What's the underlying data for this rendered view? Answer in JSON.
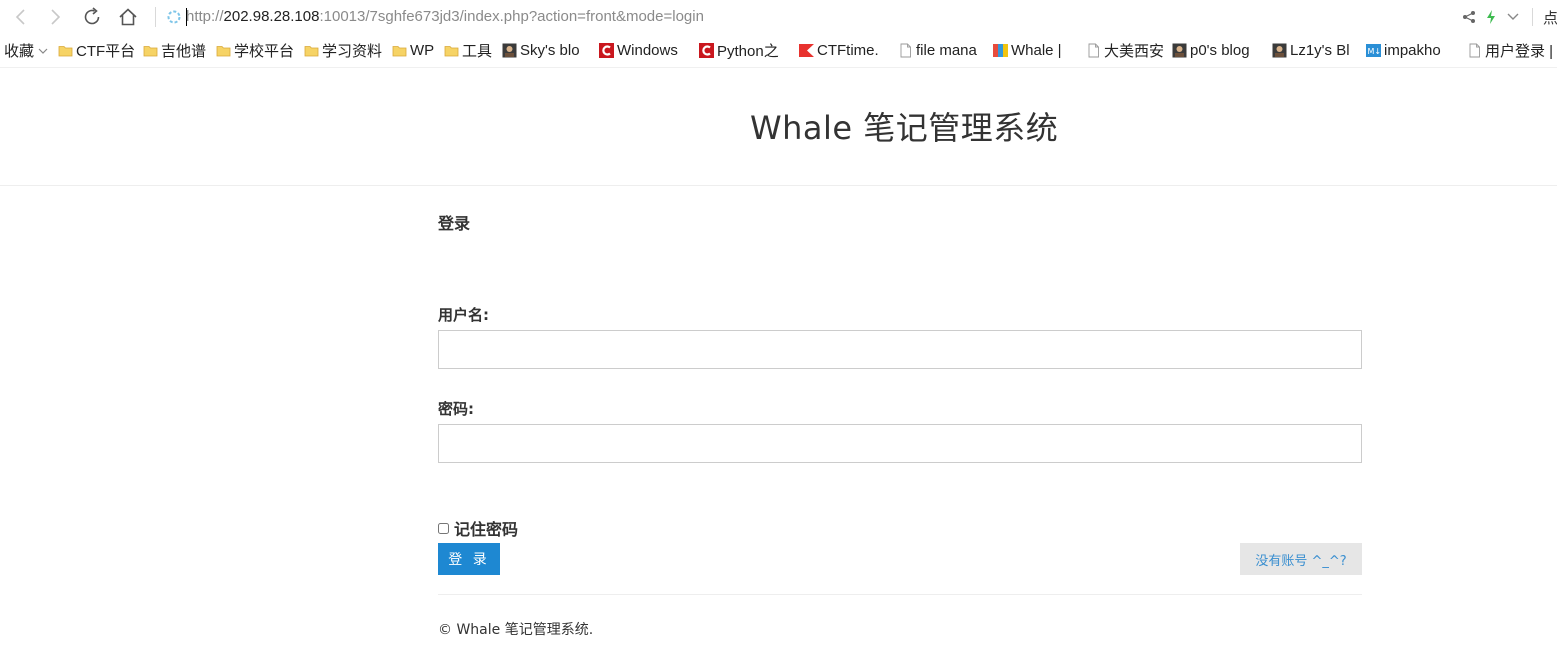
{
  "browser": {
    "url_scheme": "http://",
    "url_host": "202.98.28.108",
    "url_rest": ":10013/7sghfe673jd3/index.php?action=front&mode=login",
    "right_cut_text": "点"
  },
  "bookmarks": {
    "favorites_label": "收藏",
    "items": [
      {
        "label": "CTF平台",
        "icon": "folder-icon"
      },
      {
        "label": "吉他谱",
        "icon": "folder-icon"
      },
      {
        "label": "学校平台",
        "icon": "folder-icon"
      },
      {
        "label": "学习资料",
        "icon": "folder-icon"
      },
      {
        "label": "WP",
        "icon": "folder-icon"
      },
      {
        "label": "工具",
        "icon": "folder-icon"
      },
      {
        "label": "Sky's blo",
        "icon": "avatar-icon"
      },
      {
        "label": "Windows",
        "icon": "csdn-icon"
      },
      {
        "label": "Python之",
        "icon": "csdn-icon"
      },
      {
        "label": "CTFtime.",
        "icon": "ctftime-icon"
      },
      {
        "label": "file mana",
        "icon": "page-icon"
      },
      {
        "label": "Whale |",
        "icon": "whale-icon"
      },
      {
        "label": "大美西安",
        "icon": "page-icon"
      },
      {
        "label": "p0's blog",
        "icon": "avatar-icon"
      },
      {
        "label": "Lz1y's Bl",
        "icon": "avatar-icon"
      },
      {
        "label": "impakho",
        "icon": "markdown-icon"
      },
      {
        "label": "用户登录 |",
        "icon": "page-icon"
      }
    ]
  },
  "site": {
    "title": "Whale 笔记管理系统"
  },
  "login": {
    "section_title": "登录",
    "username_label": "用户名:",
    "username_value": "",
    "password_label": "密码:",
    "password_value": "",
    "remember_label": "记住密码",
    "remember_checked": false,
    "submit_label": "登 录",
    "register_label": "没有账号 ^_^?"
  },
  "footer": {
    "text": "© Whale 笔记管理系统."
  },
  "colors": {
    "primary_button": "#1e88d2",
    "secondary_button_bg": "#e6e6e6",
    "secondary_button_text": "#3a8fd0",
    "text": "#333333"
  }
}
